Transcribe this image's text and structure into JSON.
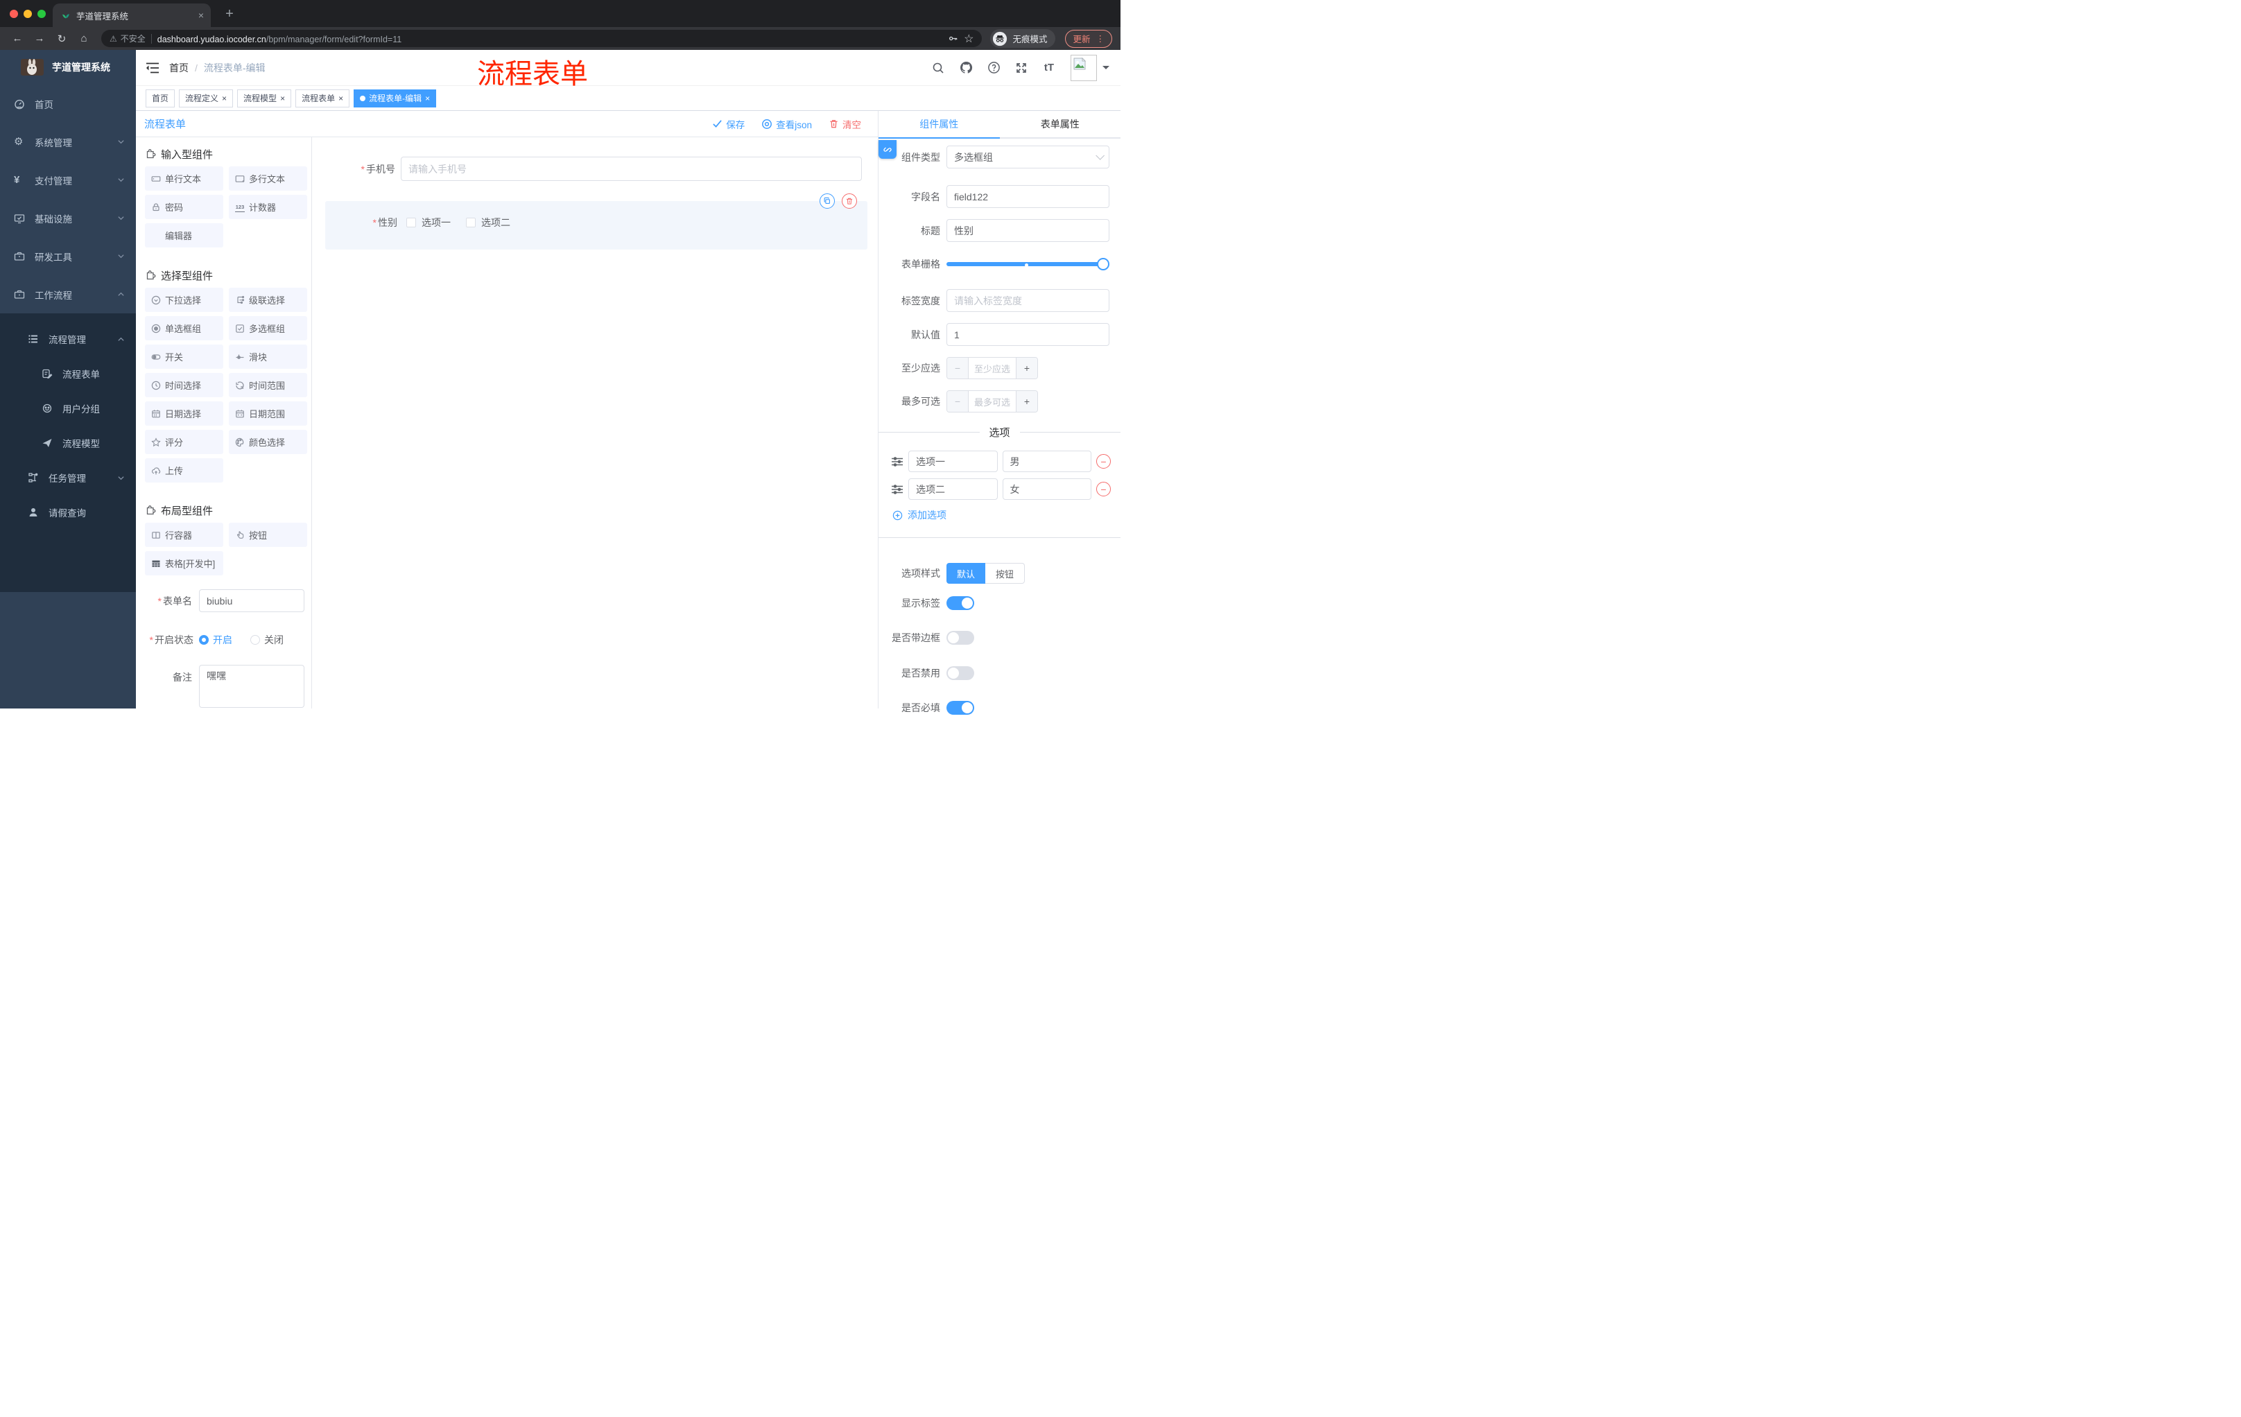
{
  "icons": {
    "warning": "⚠",
    "star": "☆",
    "back": "←",
    "forward": "→",
    "reload": "↻",
    "home": "⌂",
    "dots": "⋮",
    "plus_tab": "+",
    "close": "×",
    "gear": "⚙",
    "yen": "¥",
    "minus": "−",
    "plus": "+",
    "font_size": "tT",
    "asterisk": "*",
    "slash": "/",
    "counter": "123"
  },
  "colors": {
    "primary": "#409eff",
    "danger": "#f56c6c",
    "sidebar_bg": "#304156",
    "submenu_bg": "#1f2d3d",
    "annotation": "#ff2600",
    "active_tag_bg": "#409eff"
  },
  "browser": {
    "tab_title": "芋道管理系统",
    "security_label": "不安全",
    "url_host": "dashboard.yudao.iocoder.cn",
    "url_path": "/bpm/manager/form/edit?formId=11",
    "incognito_label": "无痕模式",
    "update_label": "更新"
  },
  "header": {
    "brand": "芋道管理系统",
    "breadcrumb_home": "首页",
    "breadcrumb_current": "流程表单-编辑",
    "annotation": "流程表单"
  },
  "sidebar": {
    "items": [
      {
        "label": "首页"
      },
      {
        "label": "系统管理"
      },
      {
        "label": "支付管理"
      },
      {
        "label": "基础设施"
      },
      {
        "label": "研发工具"
      },
      {
        "label": "工作流程"
      },
      {
        "label": "流程管理"
      },
      {
        "label": "流程表单"
      },
      {
        "label": "用户分组"
      },
      {
        "label": "流程模型"
      },
      {
        "label": "任务管理"
      },
      {
        "label": "请假查询"
      }
    ]
  },
  "tags": {
    "items": [
      {
        "label": "首页"
      },
      {
        "label": "流程定义"
      },
      {
        "label": "流程模型"
      },
      {
        "label": "流程表单"
      },
      {
        "label": "流程表单-编辑"
      }
    ]
  },
  "toolbar": {
    "title": "流程表单",
    "save": "保存",
    "view_json": "查看json",
    "clear": "清空"
  },
  "palette": {
    "sections": [
      {
        "title": "输入型组件",
        "items": [
          {
            "label": "单行文本"
          },
          {
            "label": "多行文本"
          },
          {
            "label": "密码"
          },
          {
            "label": "计数器"
          },
          {
            "label": "编辑器"
          }
        ]
      },
      {
        "title": "选择型组件",
        "items": [
          {
            "label": "下拉选择"
          },
          {
            "label": "级联选择"
          },
          {
            "label": "单选框组"
          },
          {
            "label": "多选框组"
          },
          {
            "label": "开关"
          },
          {
            "label": "滑块"
          },
          {
            "label": "时间选择"
          },
          {
            "label": "时间范围"
          },
          {
            "label": "日期选择"
          },
          {
            "label": "日期范围"
          },
          {
            "label": "评分"
          },
          {
            "label": "颜色选择"
          },
          {
            "label": "上传"
          }
        ]
      },
      {
        "title": "布局型组件",
        "items": [
          {
            "label": "行容器"
          },
          {
            "label": "按钮"
          },
          {
            "label": "表格[开发中]"
          }
        ]
      }
    ]
  },
  "meta_form": {
    "name_label": "表单名",
    "name_value": "biubiu",
    "status_label": "开启状态",
    "status_on": "开启",
    "status_off": "关闭",
    "status_selected": "开启",
    "remark_label": "备注",
    "remark_value": "嘿嘿"
  },
  "canvas": {
    "phone_label": "手机号",
    "phone_placeholder": "请输入手机号",
    "gender_label": "性别",
    "gender_option1": "选项一",
    "gender_option2": "选项二"
  },
  "panel": {
    "tab_component": "组件属性",
    "tab_form": "表单属性",
    "active_tab": "组件属性",
    "component_type_label": "组件类型",
    "component_type_value": "多选框组",
    "field_name_label": "字段名",
    "field_name_value": "field122",
    "title_label": "标题",
    "title_value": "性别",
    "grid_label": "表单栅格",
    "label_width_label": "标签宽度",
    "label_width_placeholder": "请输入标签宽度",
    "default_label": "默认值",
    "default_value": "1",
    "min_label": "至少应选",
    "min_placeholder": "至少应选",
    "max_label": "最多可选",
    "max_placeholder": "最多可选",
    "options_title": "选项",
    "options": [
      {
        "label": "选项一",
        "value": "男"
      },
      {
        "label": "选项二",
        "value": "女"
      }
    ],
    "add_option": "添加选项",
    "style_label": "选项样式",
    "style_default": "默认",
    "style_button": "按钮",
    "style_selected": "默认",
    "toggles": [
      {
        "label": "显示标签",
        "on": true
      },
      {
        "label": "是否带边框",
        "on": false
      },
      {
        "label": "是否禁用",
        "on": false
      },
      {
        "label": "是否必填",
        "on": true
      }
    ]
  }
}
